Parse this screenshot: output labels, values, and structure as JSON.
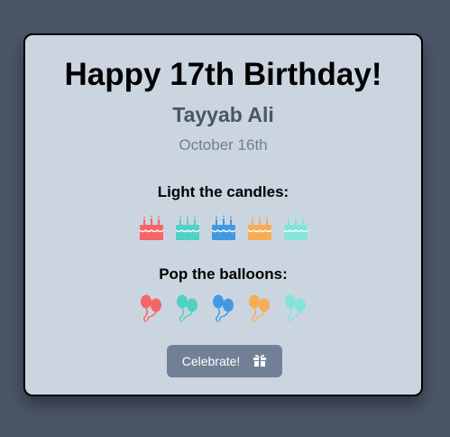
{
  "card": {
    "title": "Happy 17th Birthday!",
    "name": "Tayyab Ali",
    "date": "October 16th"
  },
  "candles": {
    "label": "Light the candles:",
    "colors": [
      "#f56565",
      "#4fd1c5",
      "#4299e1",
      "#f6ad55",
      "#81e6d9"
    ],
    "icon": "birthday-cake-icon"
  },
  "balloons": {
    "label": "Pop the balloons:",
    "colors": [
      "#f56565",
      "#4fd1c5",
      "#4299e1",
      "#f6ad55",
      "#81e6d9"
    ],
    "icon": "balloons-icon"
  },
  "button": {
    "label": "Celebrate!",
    "icon": "gift-icon",
    "background": "#718096"
  },
  "colors": {
    "page_background": "#4a5568",
    "card_background": "#cbd5e0"
  }
}
